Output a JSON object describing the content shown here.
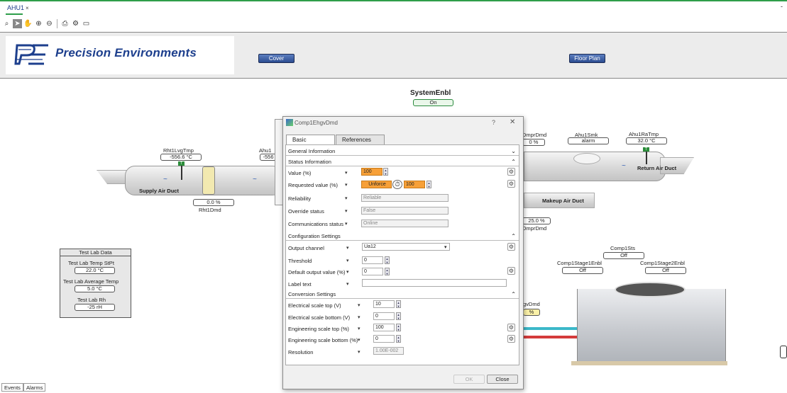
{
  "window": {
    "tab_label": "AHU1",
    "tab_close": "×",
    "minimize": "-"
  },
  "toolbar": {
    "tools": [
      "binoculars-icon",
      "pointer-icon",
      "hand-icon",
      "zoom-in-icon",
      "zoom-out-icon",
      "print-icon",
      "print-settings-icon",
      "preview-icon"
    ]
  },
  "header": {
    "logo_text": "Precision Environments",
    "cover_label": "Cover",
    "floorplan_label": "Floor Plan"
  },
  "system": {
    "title": "SystemEnbl",
    "value": "On"
  },
  "supply": {
    "rht1lvg_label": "Rht1LvgTmp",
    "rht1lvg_value": "-556.6 °C",
    "flag": "T",
    "duct_label": "Supply Air Duct",
    "rht1dmd_value": "0.0 %",
    "rht1dmd_label": "Rht1Dmd",
    "ahu1_partial": "Ahu1",
    "ahu1_partial_value": "-556"
  },
  "return": {
    "dmpr_label": "DmprDmd",
    "dmpr_value": "0 %",
    "smk_label": "Ahu1Smk",
    "smk_value": "alarm",
    "ra_label": "Ahu1RaTmp",
    "ra_value": "32.0 °C",
    "flag": "T",
    "duct_label": "Return Air Duct"
  },
  "makeup": {
    "duct_label": "Makeup Air Duct",
    "dmpr_value": "25.0 %",
    "dmpr_label": "DmprDmd"
  },
  "comp": {
    "sts_label": "Comp1Sts",
    "sts_value": "Off",
    "stage1_label": "Comp1Stage1Enbl",
    "stage1_value": "Off",
    "stage2_label": "Comp1Stage2Enbl",
    "stage2_value": "Off",
    "egv_label": "gvDmd",
    "egv_value": "%"
  },
  "testlab": {
    "title": "Test Lab Data",
    "stpt_label": "Test Lab Temp StPt",
    "stpt_value": "22.0 °C",
    "avg_label": "Test Lab Average Temp",
    "avg_value": "5.0 °C",
    "rh_label": "Test Lab Rh",
    "rh_value": "-25 rH"
  },
  "dialog": {
    "title": "Comp1EhgvDmd",
    "help": "?",
    "close_x": "✕",
    "tabs": [
      "Basic",
      "References"
    ],
    "sections": {
      "general": "General Information",
      "status": "Status Information",
      "config": "Configuration Settings",
      "conversion": "Conversion Settings"
    },
    "status_rows": {
      "value_label": "Value (%)",
      "value": "100",
      "requested_label": "Requested value (%)",
      "unforce": "Unforce",
      "requested_value": "100",
      "reliability_label": "Reliability",
      "reliability": "Reliable",
      "override_label": "Override status",
      "override": "False",
      "comm_label": "Communications status",
      "comm": "Online"
    },
    "config_rows": {
      "channel_label": "Output channel",
      "channel": "Ua12",
      "threshold_label": "Threshold",
      "threshold": "0",
      "default_label": "Default output value (%)",
      "default": "0",
      "labeltext_label": "Label text",
      "labeltext": ""
    },
    "conversion_rows": {
      "esct_label": "Electrical scale top (V)",
      "esct": "10",
      "escb_label": "Electrical scale bottom (V)",
      "escb": "0",
      "engt_label": "Engineering scale top (%)",
      "engt": "100",
      "engb_label": "Engineering scale bottom (%)",
      "engb": "0",
      "res_label": "Resolution",
      "res": "1.00E-002"
    },
    "ok_label": "OK",
    "close_label": "Close"
  },
  "bottom": {
    "events_label": "Events",
    "alarms_label": "Alarms"
  },
  "colors": {
    "brand": "#1d3f8d",
    "accent_green": "#2e9e4a",
    "orange": "#f7a038"
  }
}
